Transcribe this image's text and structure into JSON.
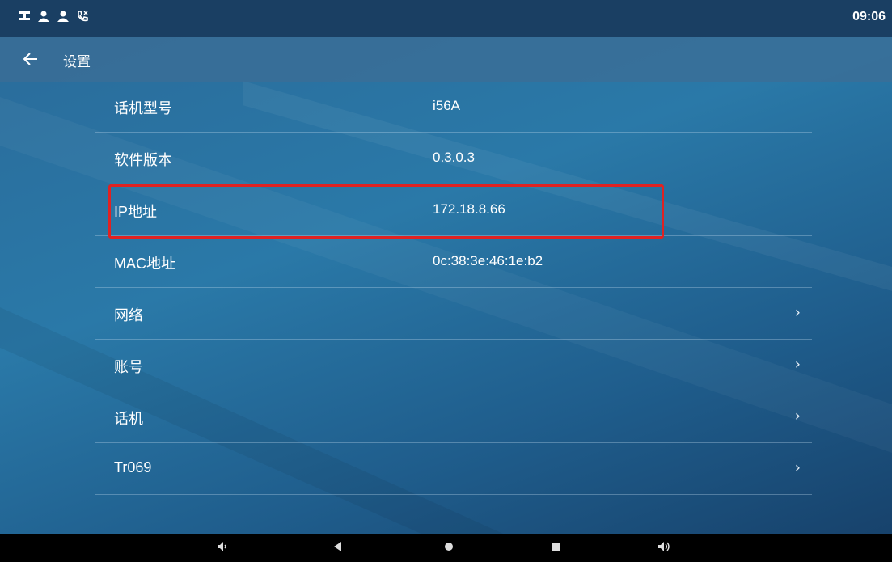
{
  "status_bar": {
    "time": "09:06",
    "icons": [
      "network-icon",
      "contact-icon",
      "contact-icon",
      "missed-call-icon"
    ]
  },
  "header": {
    "back_icon": "arrow-left-icon",
    "title": "设置"
  },
  "settings": {
    "rows": [
      {
        "label": "话机型号",
        "value": "i56A",
        "has_chevron": false
      },
      {
        "label": "软件版本",
        "value": "0.3.0.3",
        "has_chevron": false
      },
      {
        "label": "IP地址",
        "value": "172.18.8.66",
        "has_chevron": false,
        "highlighted": true
      },
      {
        "label": "MAC地址",
        "value": "0c:38:3e:46:1e:b2",
        "has_chevron": false
      },
      {
        "label": "网络",
        "value": "",
        "has_chevron": true
      },
      {
        "label": "账号",
        "value": "",
        "has_chevron": true
      },
      {
        "label": "话机",
        "value": "",
        "has_chevron": true
      },
      {
        "label": "Tr069",
        "value": "",
        "has_chevron": true
      }
    ],
    "chevron_glyph": "›"
  },
  "nav_bar": {
    "buttons": [
      "volume-down-icon",
      "back-triangle-icon",
      "home-circle-icon",
      "recents-square-icon",
      "volume-up-icon"
    ]
  },
  "colors": {
    "status_bar": "#1a3f63",
    "highlight_border": "#e02222",
    "nav_bar": "#000000"
  }
}
